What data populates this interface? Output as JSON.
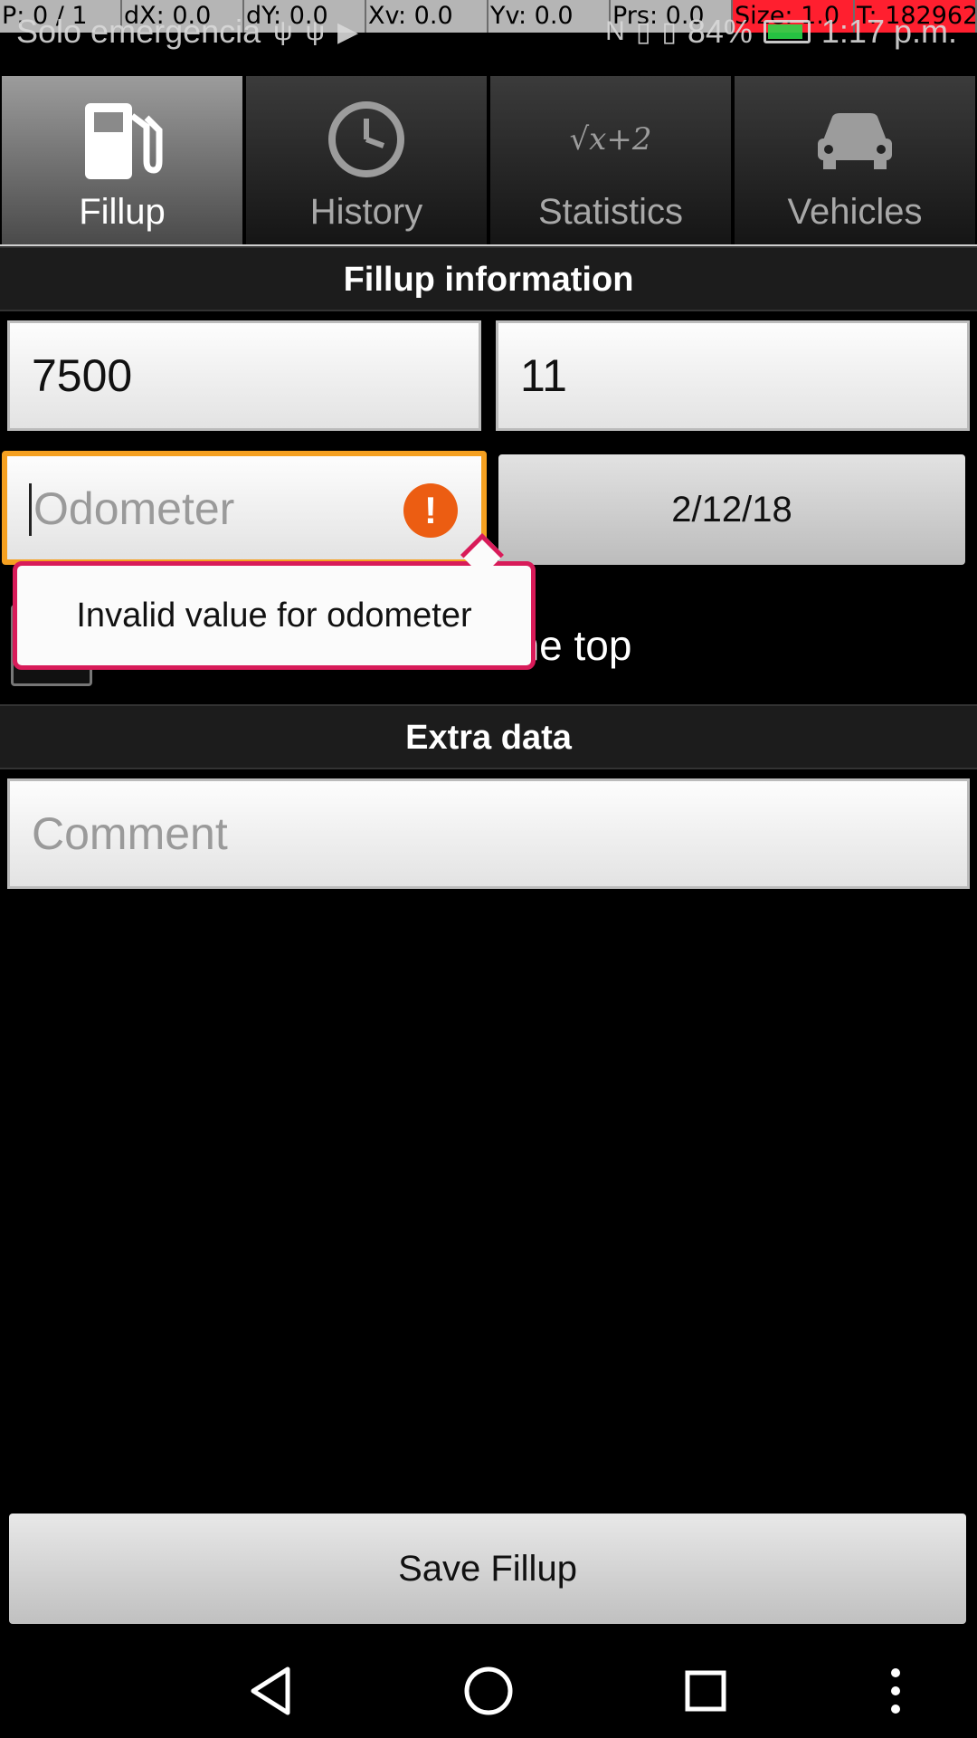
{
  "debug_bar": {
    "p": "P: 0 / 1",
    "dx": "dX: 0.0",
    "dy": "dY: 0.0",
    "xv": "Xv: 0.0",
    "yv": "Yv: 0.0",
    "prs": "Prs: 0.0",
    "size": "Size: 1.0",
    "t": "T: 182962"
  },
  "status_bar": {
    "carrier": "Solo emergencia",
    "battery": "84%",
    "time": "1:17 p.m."
  },
  "tabs": [
    {
      "label": "Fillup",
      "icon": "fuel-pump-icon",
      "active": true
    },
    {
      "label": "History",
      "icon": "clock-icon",
      "active": false
    },
    {
      "label": "Statistics",
      "icon": "formula-icon",
      "active": false
    },
    {
      "label": "Vehicles",
      "icon": "car-icon",
      "active": false
    }
  ],
  "statistics_icon_text": "√x+2",
  "fillup": {
    "section_title": "Fillup information",
    "price_value": "7500",
    "volume_value": "11",
    "odometer_placeholder": "Odometer",
    "odometer_error_symbol": "!",
    "date_label": "2/12/18",
    "partial_checkbox_label": "Tank was not filled to the top",
    "error_tooltip": "Invalid value for odometer"
  },
  "extra": {
    "section_title": "Extra data",
    "comment_placeholder": "Comment"
  },
  "save_button_label": "Save Fillup"
}
